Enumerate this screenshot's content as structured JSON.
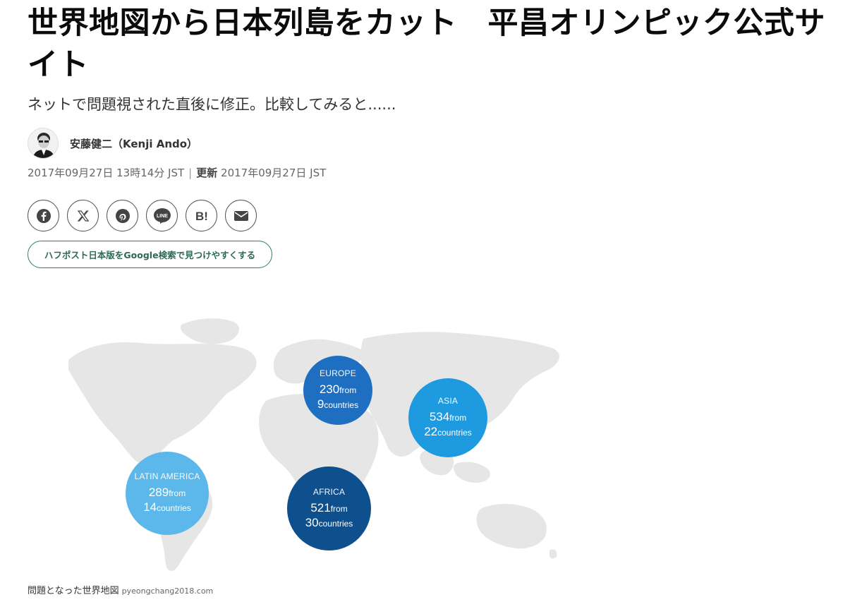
{
  "article": {
    "headline": "世界地図から日本列島をカット　平昌オリンピック公式サイト",
    "subhead": "ネットで問題視された直後に修正。比較してみると......",
    "author": "安藤健二（Kenji Ando）",
    "published": "2017年09月27日 13時14分 JST",
    "updated_label": "更新",
    "updated": "2017年09月27日 JST"
  },
  "share": {
    "buttons": [
      {
        "name": "facebook",
        "icon": "facebook-icon"
      },
      {
        "name": "x",
        "icon": "x-icon"
      },
      {
        "name": "pinterest",
        "icon": "pinterest-icon"
      },
      {
        "name": "line",
        "icon": "line-icon"
      },
      {
        "name": "hatena",
        "icon": "hatena-bookmark-icon"
      },
      {
        "name": "email",
        "icon": "mail-icon"
      }
    ],
    "line_label": "LINE",
    "hatena_label": "B!"
  },
  "google_button": "ハフポスト日本版をGoogle検索で見つけやすくする",
  "figure": {
    "bubbles": [
      {
        "region": "EUROPE",
        "num1": "230",
        "from": "from",
        "num2": "9",
        "countries": "countries",
        "color": "#1e6fc2"
      },
      {
        "region": "ASIA",
        "num1": "534",
        "from": "from",
        "num2": "22",
        "countries": "countries",
        "color": "#1d9ae0"
      },
      {
        "region": "LATIN AMERICA",
        "num1": "289",
        "from": "from",
        "num2": "14",
        "countries": "countries",
        "color": "#5cb8ea"
      },
      {
        "region": "AFRICA",
        "num1": "521",
        "from": "from",
        "num2": "30",
        "countries": "countries",
        "color": "#0e4f8d"
      }
    ],
    "caption": "問題となった世界地図",
    "credit": "pyeongchang2018.com"
  }
}
